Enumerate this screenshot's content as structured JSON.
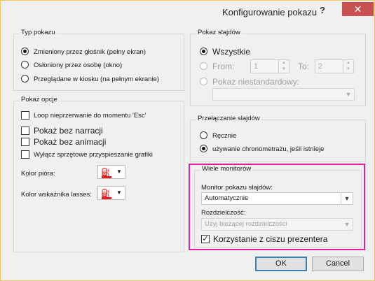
{
  "window": {
    "title": "Konfigurowanie pokazu",
    "help": "?",
    "close": "✕"
  },
  "show_type": {
    "title": "Typ pokazu",
    "options": [
      "Zmieniony przez głośnik (pełny ekran)",
      "Osłoniony przez osobę (okno)",
      "Przeglądane w kiosku (na pełnym ekranie)"
    ]
  },
  "show_options": {
    "title": "Pokaż opcje",
    "loop": "Loop nieprzerwanie do momentu 'Esc'",
    "no_narration": "Pokaż bez narracji",
    "no_animation": "Pokaż bez animacji",
    "disable_hw": "Wyłącz sprzętowe przyspieszanie grafiki",
    "pen_color": "Kolor pióra:",
    "laser_color": "Kolor wskaźnika lasses:"
  },
  "show_slides": {
    "title": "Pokaz slajdów",
    "all": "Wszystkie",
    "from": "From:",
    "from_value": "1",
    "to": "To:",
    "to_value": "2",
    "custom": "Pokaz niestandardowy:"
  },
  "advance": {
    "title": "Przełączanie slajdów",
    "manual": "Ręcznie",
    "timings": "używanie chronometrażu, jeśli istnieje"
  },
  "monitors": {
    "title": "Wiele monitorów",
    "monitor_label": "Monitor pokazu slajdów:",
    "monitor_value": "Automatycznie",
    "resolution_label": "Rozdzielczość:",
    "resolution_value": "Użyj bieżącej rozdzielczości",
    "presenter_view": "Korzystanie z ciszu prezentera"
  },
  "buttons": {
    "ok": "OK",
    "cancel": "Cancel"
  },
  "colors": {
    "accent_highlight": "#e020a0",
    "close_bg": "#c75050",
    "pen_red": "#e02020"
  }
}
